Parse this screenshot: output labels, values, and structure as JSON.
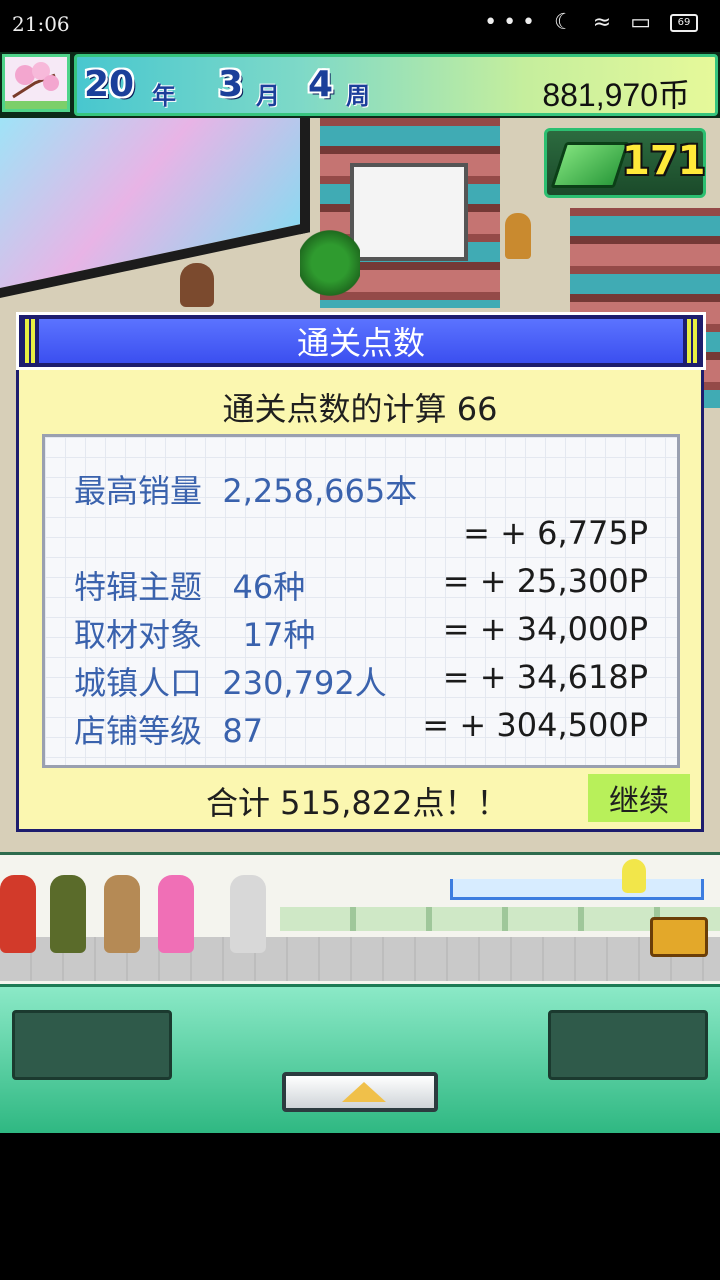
{
  "status_bar": {
    "time": "21:06",
    "battery": "69"
  },
  "hud": {
    "year": "20",
    "year_unit": "年",
    "month": "3",
    "month_unit": "月",
    "week": "4",
    "week_unit": "周",
    "money": "881,970币",
    "books": "171"
  },
  "dialog": {
    "title": "通关点数",
    "subtitle": "通关点数的计算 66",
    "rows": [
      {
        "label": "最高销量  2,258,665本",
        "points": ""
      },
      {
        "label": "",
        "points": "= + 6,775P"
      },
      {
        "label": "特辑主题   46种",
        "points": "= + 25,300P"
      },
      {
        "label": "取材对象    17种",
        "points": "= + 34,000P"
      },
      {
        "label": "城镇人口  230,792人",
        "points": "= + 34,618P"
      },
      {
        "label": "店铺等级  87",
        "points": "= + 304,500P"
      }
    ],
    "total": "合计 515,822点！！",
    "continue_label": "继续"
  },
  "colors": {
    "dialog_header": "#4a5ff5",
    "dialog_body": "#fbf7b0",
    "label_blue": "#3a62ad",
    "continue_button": "#b8f05a",
    "hud_money_text": "#111111",
    "book_count": "#ffe93a"
  },
  "icons": {
    "hud_thumbnail": "cherry-blossom-thumbnail",
    "book_icon": "green-book-icon",
    "menu_button": "up-triangle-icon",
    "treasure": "treasure-chest-icon"
  }
}
